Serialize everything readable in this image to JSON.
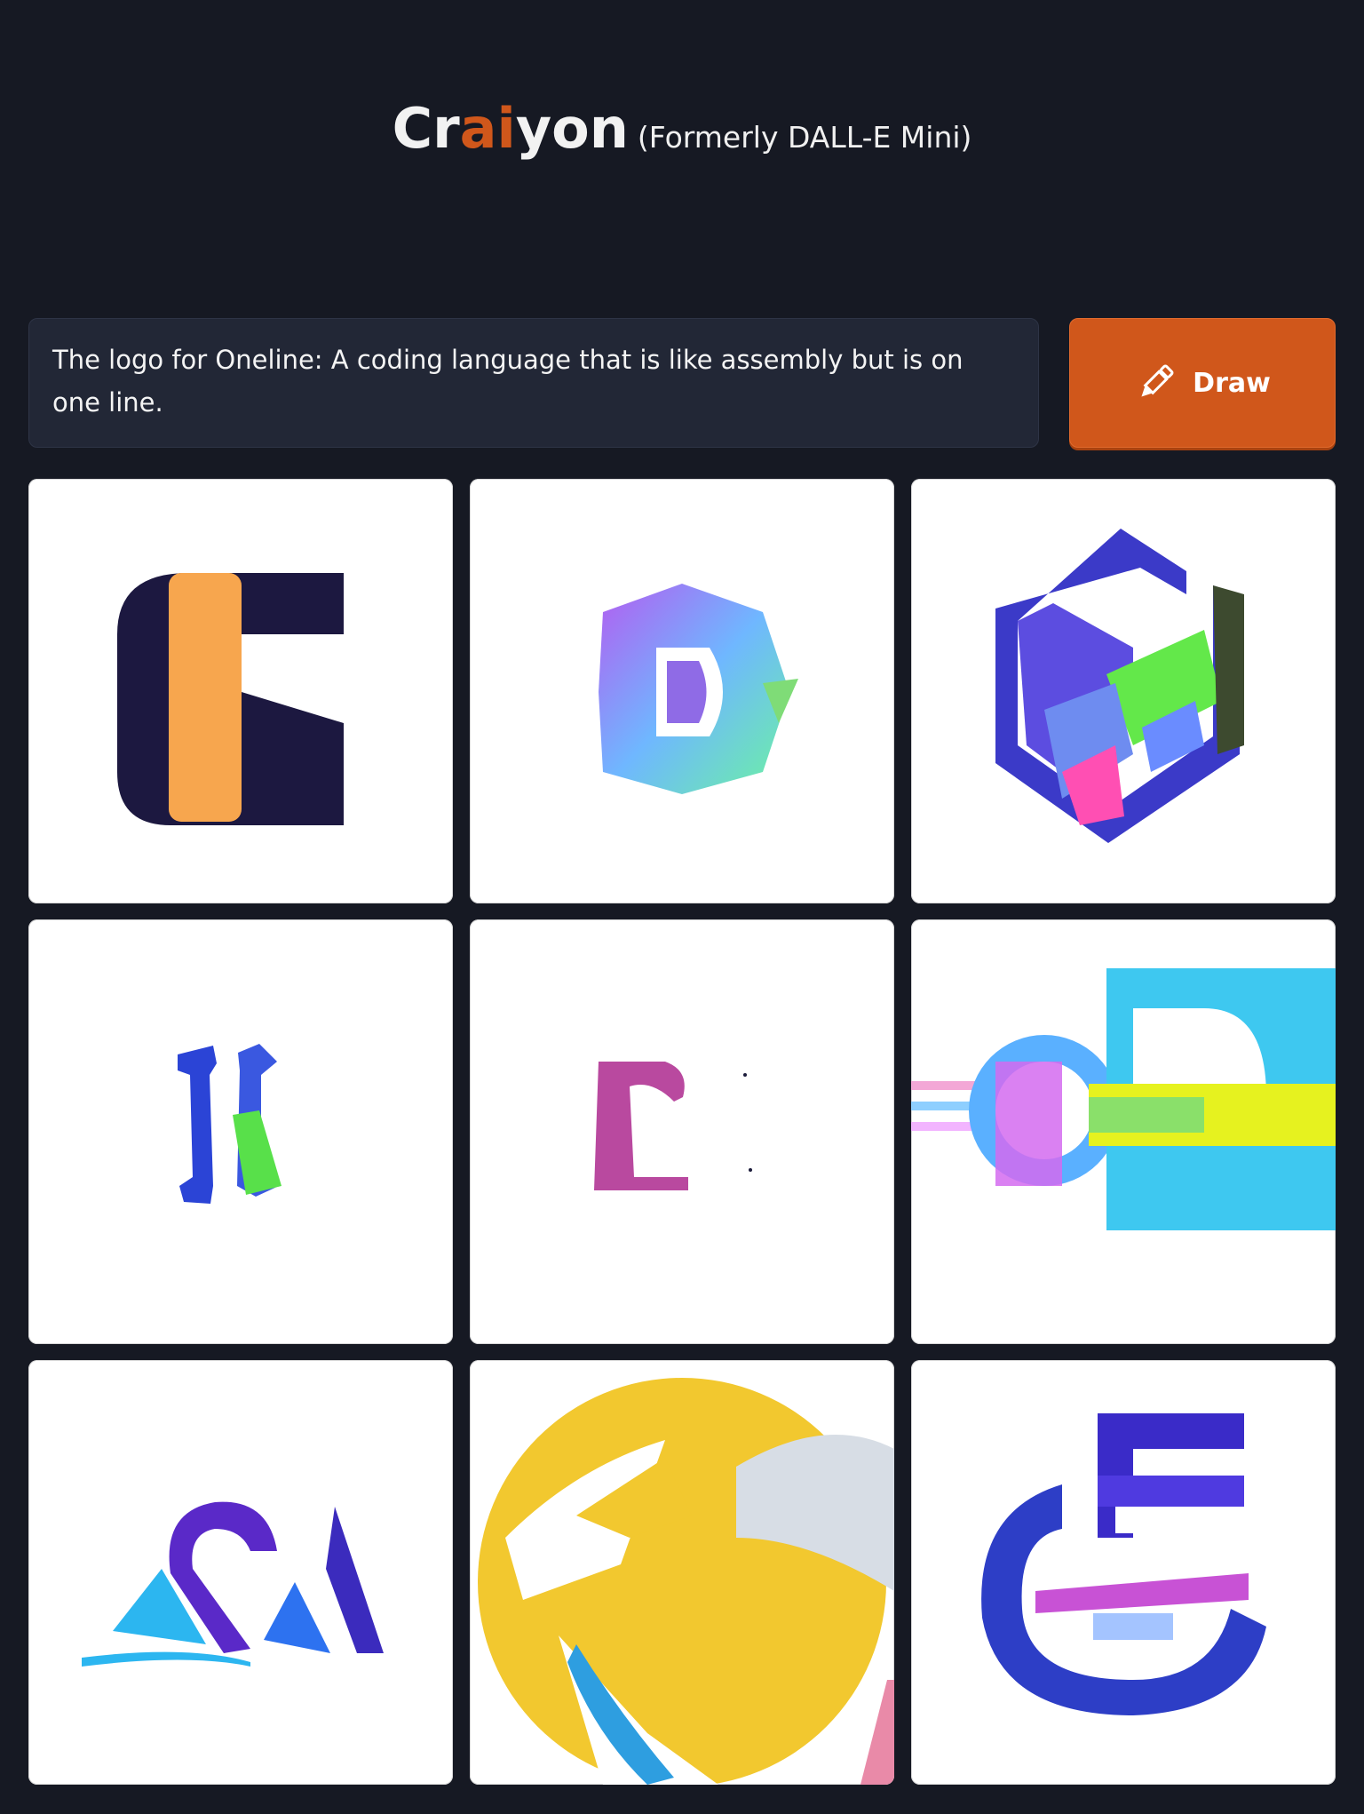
{
  "header": {
    "brand_prefix": "Cr",
    "brand_accent": "ai",
    "brand_suffix": "yon",
    "subtitle": "(Formerly DALL-E Mini)"
  },
  "prompt": {
    "value": "The logo for Oneline: A coding language that is like assembly but is on one line."
  },
  "draw_button": {
    "label": "Draw",
    "icon": "pencil-icon"
  },
  "results": {
    "count": 9,
    "images": [
      {
        "name": "generated-image-1"
      },
      {
        "name": "generated-image-2"
      },
      {
        "name": "generated-image-3"
      },
      {
        "name": "generated-image-4"
      },
      {
        "name": "generated-image-5"
      },
      {
        "name": "generated-image-6"
      },
      {
        "name": "generated-image-7"
      },
      {
        "name": "generated-image-8"
      },
      {
        "name": "generated-image-9"
      }
    ]
  },
  "colors": {
    "background": "#161923",
    "accent": "#d0571b",
    "prompt_background": "#222736",
    "tile_background": "#ffffff"
  }
}
